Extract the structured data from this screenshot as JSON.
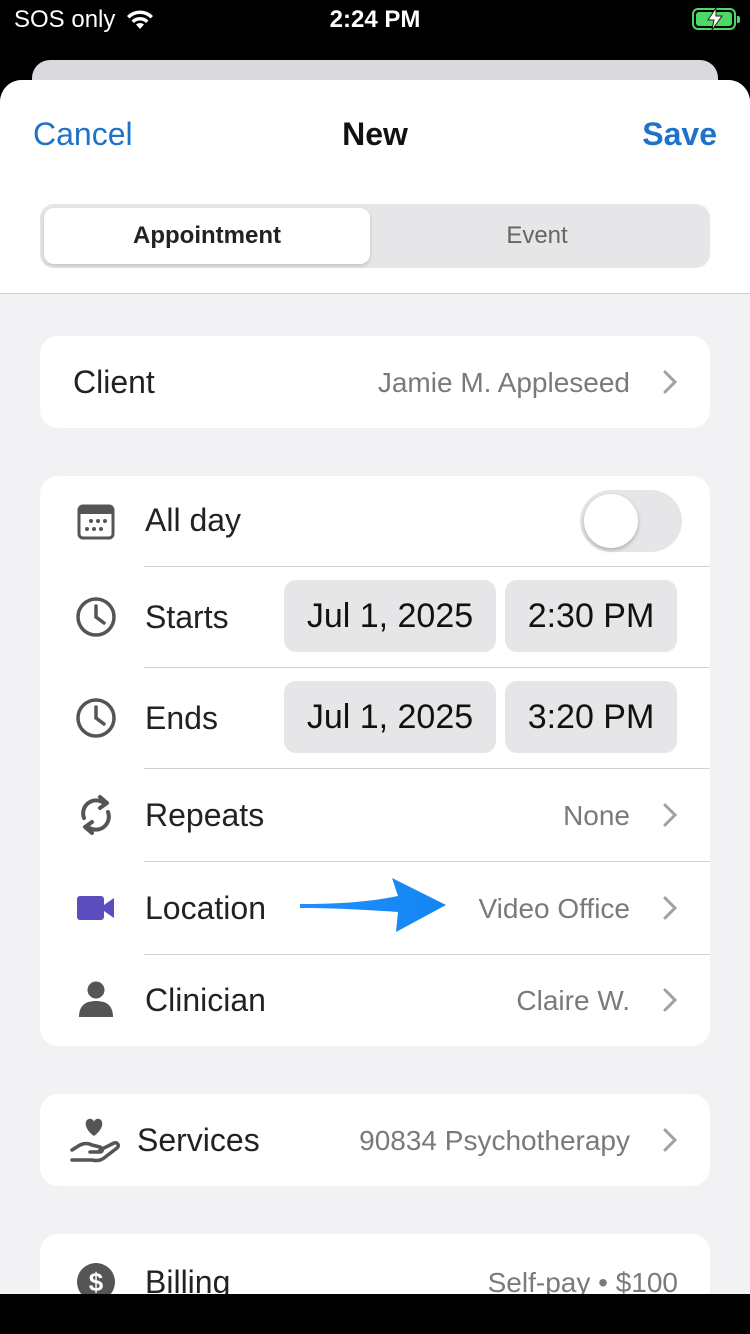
{
  "status_bar": {
    "carrier": "SOS only",
    "time": "2:24 PM"
  },
  "nav": {
    "cancel": "Cancel",
    "title": "New",
    "save": "Save"
  },
  "segments": {
    "appointment": "Appointment",
    "event": "Event"
  },
  "client": {
    "label": "Client",
    "value": "Jamie M. Appleseed"
  },
  "schedule": {
    "all_day": {
      "label": "All day",
      "on": false
    },
    "starts": {
      "label": "Starts",
      "date": "Jul 1, 2025",
      "time": "2:30 PM"
    },
    "ends": {
      "label": "Ends",
      "date": "Jul 1, 2025",
      "time": "3:20 PM"
    },
    "repeats": {
      "label": "Repeats",
      "value": "None"
    },
    "location": {
      "label": "Location",
      "value": "Video Office"
    },
    "clinician": {
      "label": "Clinician",
      "value": "Claire W."
    }
  },
  "services": {
    "label": "Services",
    "value": "90834 Psychotherapy"
  },
  "billing": {
    "label": "Billing",
    "value": "Self-pay • $100"
  },
  "colors": {
    "accent": "#1e73c8",
    "video_icon": "#5b4dbd",
    "arrow": "#1e90ff",
    "battery": "#4cd964"
  },
  "icons": [
    "wifi-icon",
    "battery-icon",
    "calendar-icon",
    "clock-icon",
    "repeat-icon",
    "video-camera-icon",
    "person-icon",
    "heart-hand-icon",
    "dollar-icon",
    "chevron-right-icon",
    "arrow-annotation"
  ]
}
